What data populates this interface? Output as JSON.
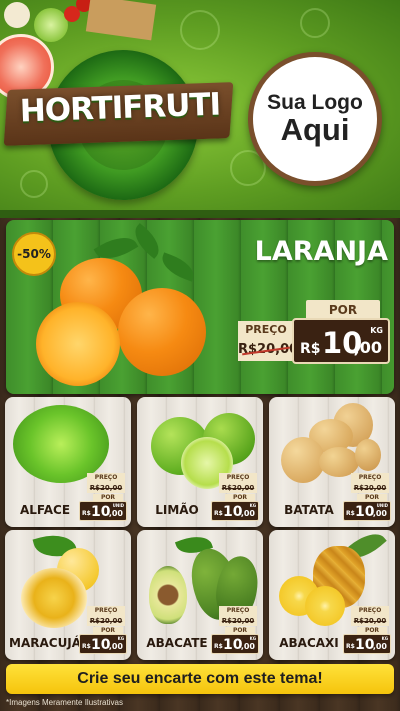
{
  "header": {
    "brand": "HORTIFRUTI",
    "logo_line1": "Sua Logo",
    "logo_line2": "Aqui"
  },
  "featured": {
    "badge": "-50%",
    "name": "LARANJA",
    "old_label": "PREÇO",
    "old_price": "R$20,00",
    "por_label": "POR",
    "currency": "R$",
    "price_int": "10",
    "price_dec": ",00",
    "unit": "KG"
  },
  "products": [
    {
      "name": "ALFACE",
      "preco_label": "PREÇO",
      "old_price": "R$20,00",
      "por_label": "POR",
      "currency": "R$",
      "price_int": "10",
      "price_dec": ",00",
      "unit": "UNID"
    },
    {
      "name": "LIMÃO",
      "preco_label": "PREÇO",
      "old_price": "R$20,00",
      "por_label": "POR",
      "currency": "R$",
      "price_int": "10",
      "price_dec": ",00",
      "unit": "KG"
    },
    {
      "name": "BATATA",
      "preco_label": "PREÇO",
      "old_price": "R$20,00",
      "por_label": "POR",
      "currency": "R$",
      "price_int": "10",
      "price_dec": ",00",
      "unit": "UNID"
    },
    {
      "name": "MARACUJÁ",
      "preco_label": "PREÇO",
      "old_price": "R$20,00",
      "por_label": "POR",
      "currency": "R$",
      "price_int": "10",
      "price_dec": ",00",
      "unit": "KG"
    },
    {
      "name": "ABACATE",
      "preco_label": "PREÇO",
      "old_price": "R$20,00",
      "por_label": "POR",
      "currency": "R$",
      "price_int": "10",
      "price_dec": ",00",
      "unit": "KG"
    },
    {
      "name": "ABACAXI",
      "preco_label": "PREÇO",
      "old_price": "R$20,00",
      "por_label": "POR",
      "currency": "R$",
      "price_int": "10",
      "price_dec": ",00",
      "unit": "KG"
    }
  ],
  "cta": "Crie seu encarte com este tema!",
  "disclaimer": "*Imagens Meramente Ilustrativas",
  "colors": {
    "header_green": "#5f9e22",
    "wood_dark": "#3a2a1c",
    "price_box": "#3a2212",
    "badge_yellow": "#f4c21a",
    "cta_yellow": "#f5c40c"
  },
  "icons": [
    "orange-icon",
    "lettuce-icon",
    "lime-icon",
    "potato-icon",
    "passion-fruit-icon",
    "avocado-icon",
    "pineapple-icon"
  ]
}
